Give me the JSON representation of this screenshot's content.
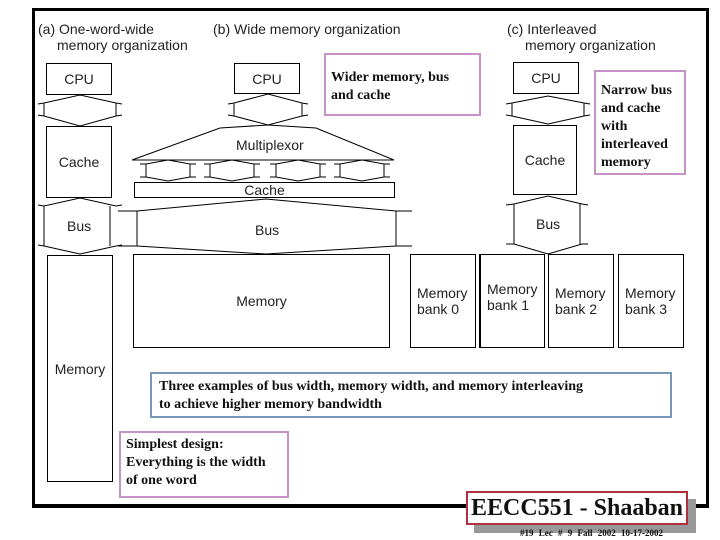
{
  "panels": {
    "a": {
      "title_line1": "(a) One-word-wide",
      "title_line2": "memory organization",
      "cpu": "CPU",
      "cache": "Cache",
      "bus": "Bus",
      "memory": "Memory"
    },
    "b": {
      "title": "(b) Wide memory organization",
      "cpu": "CPU",
      "multiplexor": "Multiplexor",
      "cache": "Cache",
      "bus": "Bus",
      "memory": "Memory"
    },
    "c": {
      "title_line1": "(c) Interleaved",
      "title_line2": "memory organization",
      "cpu": "CPU",
      "cache": "Cache",
      "bus": "Bus",
      "banks": [
        {
          "line1": "Memory",
          "line2": "bank 0"
        },
        {
          "line1": "Memory",
          "line2": "bank 1"
        },
        {
          "line1": "Memory",
          "line2": "bank 2"
        },
        {
          "line1": "Memory",
          "line2": "bank 3"
        }
      ]
    }
  },
  "notes": {
    "wider": [
      "Wider memory, bus",
      "and cache"
    ],
    "narrow": [
      "Narrow bus",
      "and cache",
      "with",
      "interleaved",
      "memory"
    ],
    "three_examples": [
      "Three examples of bus width, memory width, and memory interleaving",
      "to achieve higher memory bandwidth"
    ],
    "simplest": [
      "Simplest design:",
      "Everything is the width",
      "of one word"
    ]
  },
  "colors": {
    "note_pink_border": "#c792c8",
    "note_blue_border": "#7a96b8",
    "badge_border": "#b03040"
  },
  "footer": {
    "badge": "EECC551 - Shaaban",
    "slide": "#19",
    "lecture": "Lec # 9",
    "term": "Fall 2002",
    "date": "10-17-2002"
  }
}
